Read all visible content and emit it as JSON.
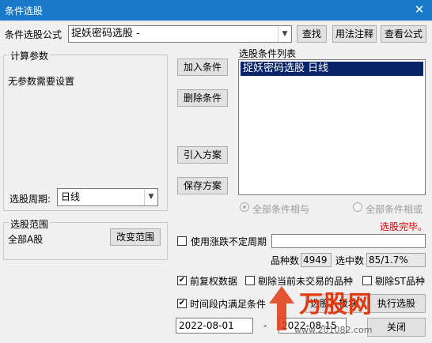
{
  "window": {
    "title": "条件选股",
    "close_glyph": "✕"
  },
  "formula": {
    "label": "条件选股公式",
    "value": "捉妖密码选股 -",
    "find_button": "查找",
    "usage_button": "用法注释",
    "view_button": "查看公式"
  },
  "params": {
    "group_title": "计算参数",
    "no_params_text": "无参数需要设置",
    "period_label": "选股周期:",
    "period_value": "日线"
  },
  "actions": {
    "add_condition": "加入条件",
    "delete_condition": "删除条件",
    "import_plan": "引入方案",
    "save_plan": "保存方案"
  },
  "condition_list": {
    "title": "选股条件列表",
    "items": [
      "捉妖密码选股  日线"
    ]
  },
  "logic": {
    "and_label": "全部条件相与",
    "or_label": "全部条件相或"
  },
  "status": {
    "text": "选股完毕。",
    "color": "#e00000"
  },
  "range": {
    "group_title": "选股范围",
    "value": "全部A股",
    "change_button": "改变范围"
  },
  "variable_period": {
    "label": "使用涨跌不定周期",
    "checked": false,
    "value": ""
  },
  "stats": {
    "count_label": "品种数",
    "count_value": "4949",
    "selected_label": "选中数",
    "selected_value": "85/1.7%"
  },
  "options": {
    "adjust_label": "前复权数据",
    "adjust_checked": true,
    "exclude_untraded_label": "剔除当前未交易的品种",
    "exclude_untraded_checked": false,
    "exclude_st_label": "剔除ST品种",
    "exclude_st_checked": false,
    "period_match_label": "时间段内满足条件",
    "period_match_checked": true
  },
  "dates": {
    "start": "2022-08-01",
    "separator": "-",
    "end": "2022-08-15"
  },
  "bottom_buttons": {
    "to_block": "选股入板块",
    "execute": "执行选股",
    "close": "关闭"
  },
  "watermark": {
    "text": "万股网",
    "url": "www.201082.com"
  }
}
